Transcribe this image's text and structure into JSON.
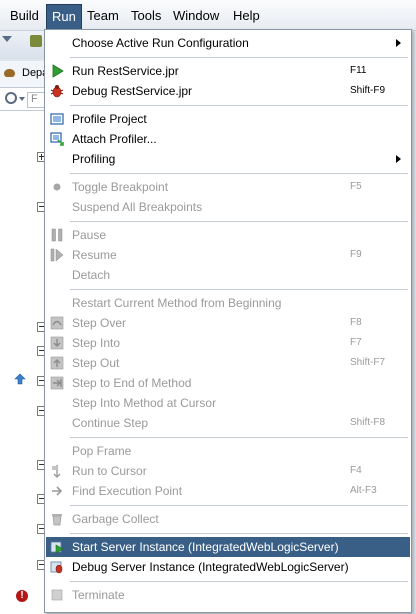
{
  "menubar": {
    "items": [
      {
        "label": "Build",
        "active": false
      },
      {
        "label": "Run",
        "active": true
      },
      {
        "label": "Team",
        "active": false
      },
      {
        "label": "Tools",
        "active": false
      },
      {
        "label": "Window",
        "active": false
      },
      {
        "label": "Help",
        "active": false
      }
    ]
  },
  "background": {
    "tab_label": "Depa",
    "search_placeholder": "F"
  },
  "menu": {
    "items": [
      {
        "label": "Choose Active Run Configuration",
        "shortcut": "",
        "disabled": false,
        "submenu": true,
        "icon": ""
      },
      {
        "label": "Run RestService.jpr",
        "shortcut": "F11",
        "disabled": false,
        "submenu": false,
        "icon": "run-icon"
      },
      {
        "label": "Debug RestService.jpr",
        "shortcut": "Shift-F9",
        "disabled": false,
        "submenu": false,
        "icon": "debug-bug-icon"
      },
      {
        "label": "Profile Project",
        "shortcut": "",
        "disabled": false,
        "submenu": false,
        "icon": "profile-icon"
      },
      {
        "label": "Attach Profiler...",
        "shortcut": "",
        "disabled": false,
        "submenu": false,
        "icon": "attach-profiler-icon"
      },
      {
        "label": "Profiling",
        "shortcut": "",
        "disabled": false,
        "submenu": true,
        "icon": ""
      },
      {
        "label": "Toggle Breakpoint",
        "shortcut": "F5",
        "disabled": true,
        "submenu": false,
        "icon": "breakpoint-dot-icon"
      },
      {
        "label": "Suspend All Breakpoints",
        "shortcut": "",
        "disabled": true,
        "submenu": false,
        "icon": ""
      },
      {
        "label": "Pause",
        "shortcut": "",
        "disabled": true,
        "submenu": false,
        "icon": "pause-icon"
      },
      {
        "label": "Resume",
        "shortcut": "F9",
        "disabled": true,
        "submenu": false,
        "icon": "resume-icon"
      },
      {
        "label": "Detach",
        "shortcut": "",
        "disabled": true,
        "submenu": false,
        "icon": ""
      },
      {
        "label": "Restart Current Method from Beginning",
        "shortcut": "",
        "disabled": true,
        "submenu": false,
        "icon": ""
      },
      {
        "label": "Step Over",
        "shortcut": "F8",
        "disabled": true,
        "submenu": false,
        "icon": "step-over-icon"
      },
      {
        "label": "Step Into",
        "shortcut": "F7",
        "disabled": true,
        "submenu": false,
        "icon": "step-into-icon"
      },
      {
        "label": "Step Out",
        "shortcut": "Shift-F7",
        "disabled": true,
        "submenu": false,
        "icon": "step-out-icon"
      },
      {
        "label": "Step to End of Method",
        "shortcut": "",
        "disabled": true,
        "submenu": false,
        "icon": "step-to-end-icon"
      },
      {
        "label": "Step Into Method at Cursor",
        "shortcut": "",
        "disabled": true,
        "submenu": false,
        "icon": ""
      },
      {
        "label": "Continue Step",
        "shortcut": "Shift-F8",
        "disabled": true,
        "submenu": false,
        "icon": ""
      },
      {
        "label": "Pop Frame",
        "shortcut": "",
        "disabled": true,
        "submenu": false,
        "icon": ""
      },
      {
        "label": "Run to Cursor",
        "shortcut": "F4",
        "disabled": true,
        "submenu": false,
        "icon": "run-to-cursor-icon"
      },
      {
        "label": "Find Execution Point",
        "shortcut": "Alt-F3",
        "disabled": true,
        "submenu": false,
        "icon": "execution-point-icon"
      },
      {
        "label": "Garbage Collect",
        "shortcut": "",
        "disabled": true,
        "submenu": false,
        "icon": "garbage-collect-icon"
      },
      {
        "label": "Start Server Instance (IntegratedWebLogicServer)",
        "shortcut": "",
        "disabled": false,
        "submenu": false,
        "selected": true,
        "icon": "start-server-icon"
      },
      {
        "label": "Debug Server Instance (IntegratedWebLogicServer)",
        "shortcut": "",
        "disabled": false,
        "submenu": false,
        "icon": "debug-server-icon"
      },
      {
        "label": "Terminate",
        "shortcut": "",
        "disabled": true,
        "submenu": false,
        "icon": "terminate-icon"
      }
    ]
  },
  "colors": {
    "selection": "#3a5f86",
    "disabled_text": "#9a9a9a",
    "run_green": "#2fa02f",
    "debug_red": "#c8321e"
  }
}
